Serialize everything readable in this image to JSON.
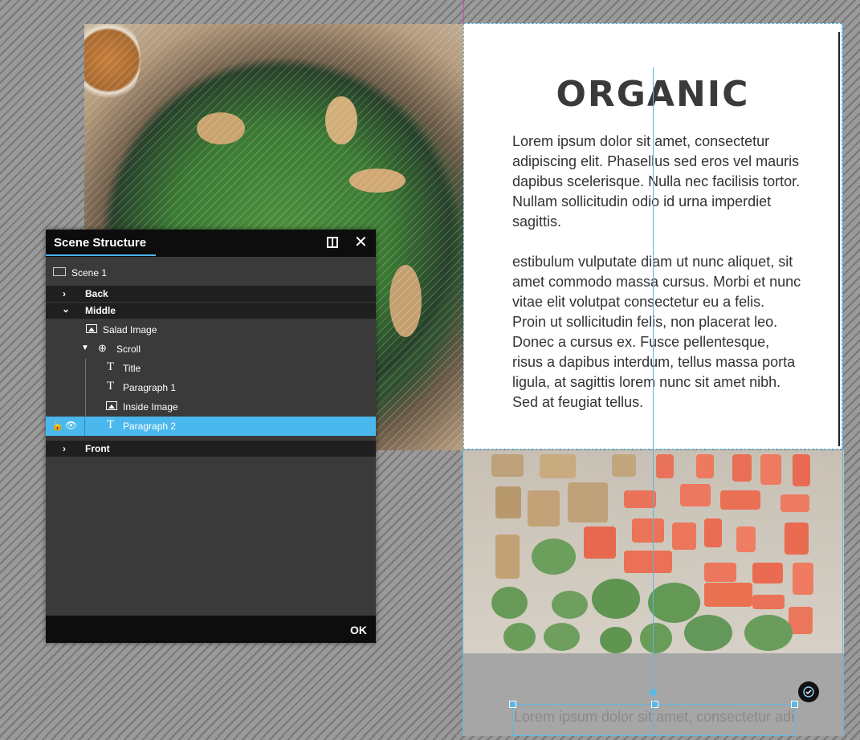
{
  "card": {
    "title": "ORGANIC",
    "paragraph1": "Lorem ipsum dolor sit amet, consectetur adipiscing elit. Phasellus sed eros vel mauris dapibus scelerisque. Nulla nec facilisis tortor. Nullam sollicitudin odio id urna imperdiet sagittis.",
    "paragraph2": "estibulum vulputate diam ut nunc aliquet, sit amet commodo massa cursus. Morbi et nunc vitae elit volutpat consectetur eu a felis. Proin ut sollicitudin felis, non placerat leo. Donec a cursus ex. Fusce pellentesque, risus a dapibus interdum, tellus massa porta ligula, at sagittis lorem nunc sit amet nibh. Sed at feugiat tellus."
  },
  "lower_text": "Lorem ipsum dolor sit amet, consectetur adipiscing elit. Phasellus sed eros vel",
  "panel": {
    "title": "Scene Structure",
    "ok_label": "OK",
    "scene": "Scene 1",
    "groups": {
      "back": "Back",
      "middle": "Middle",
      "front": "Front"
    },
    "items": {
      "salad_image": "Salad Image",
      "scroll": "Scroll",
      "title": "Title",
      "paragraph1": "Paragraph 1",
      "inside_image": "Inside Image",
      "paragraph2": "Paragraph 2"
    }
  },
  "colors": {
    "accent": "#4ab8ec",
    "guide": "#59b8e6"
  }
}
